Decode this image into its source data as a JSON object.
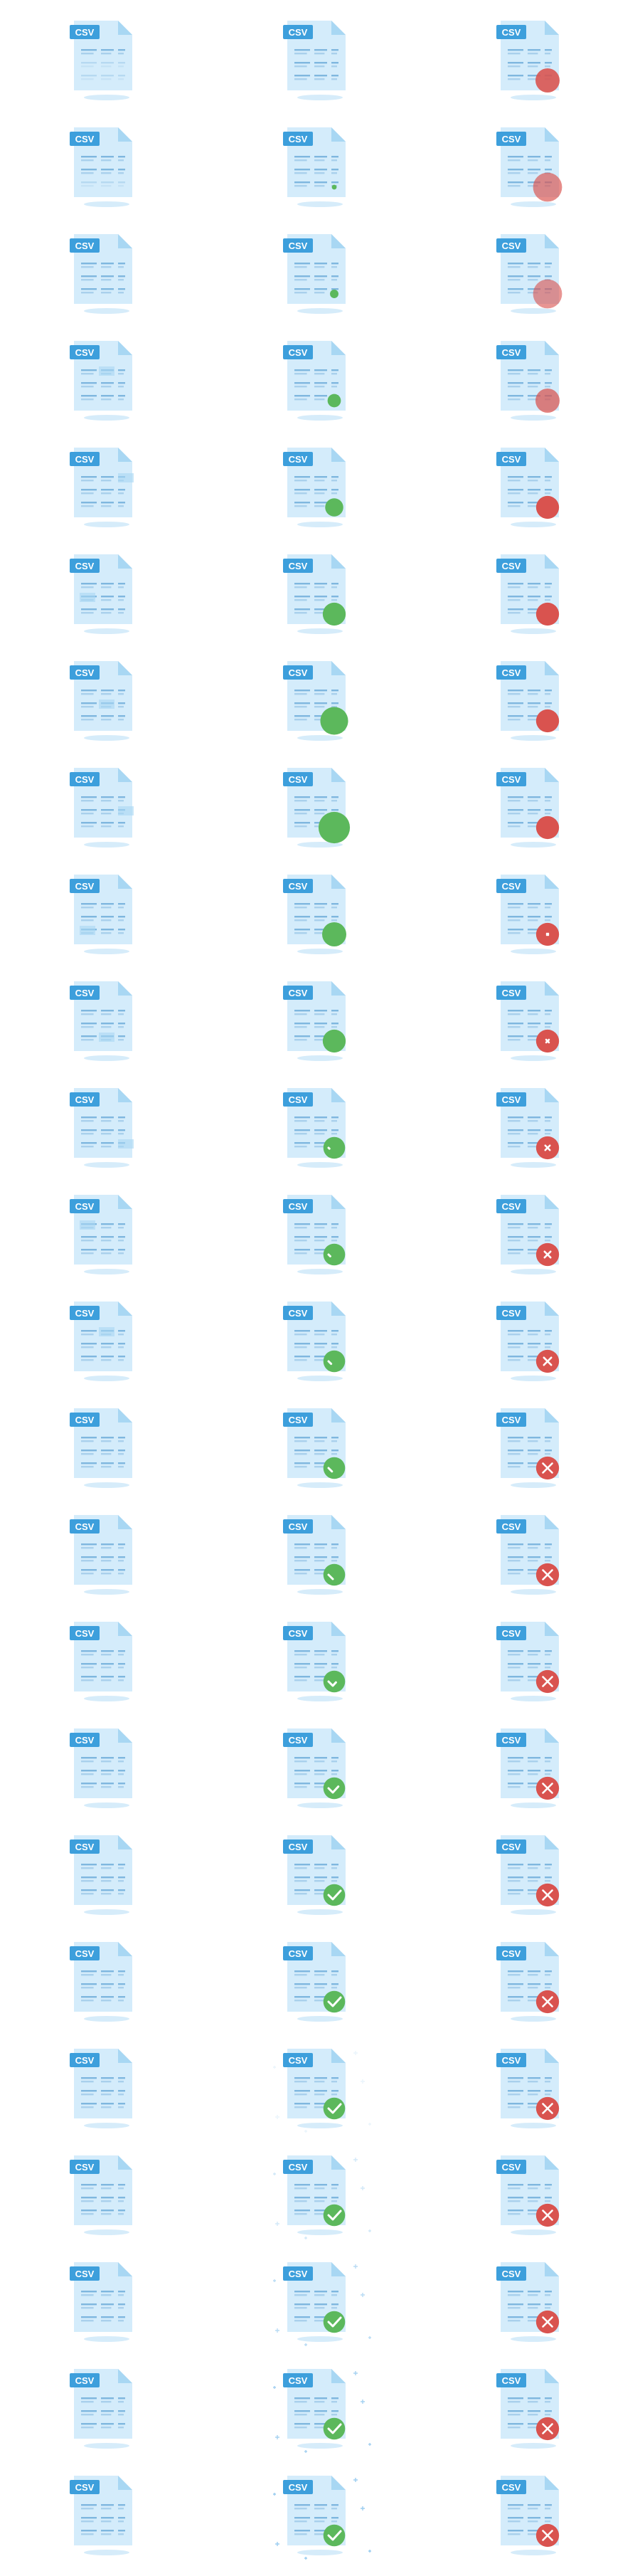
{
  "badge_label": "CSV",
  "colors": {
    "doc_body": "#d4ecfb",
    "doc_fold": "#a8d7f3",
    "doc_lines": "#7fb7df",
    "doc_lines_light": "#a9d0ec",
    "badge": "#3d9fdc",
    "shadow": "#d6ecfa",
    "success": "#5cb85c",
    "error": "#d9534f",
    "sparkle": "#9ccdf0"
  },
  "columns": [
    {
      "name": "idle",
      "frames": [
        {
          "rows": 1
        },
        {
          "rows": 2
        },
        {
          "rows": 3
        },
        {
          "rows": 3,
          "selected_cell": 1
        },
        {
          "rows": 3,
          "selected_cell": 2
        },
        {
          "rows": 3,
          "selected_cell": 3
        },
        {
          "rows": 3,
          "selected_cell": 4
        },
        {
          "rows": 3,
          "selected_cell": 5
        },
        {
          "rows": 3,
          "selected_cell": 6
        },
        {
          "rows": 3,
          "selected_cell": 7
        },
        {
          "rows": 3,
          "selected_cell": 8
        },
        {
          "rows": 3,
          "selected_cell": 9
        },
        {
          "rows": 3,
          "selected_cell": 10
        },
        {
          "rows": 3
        },
        {
          "rows": 3
        },
        {
          "rows": 3
        },
        {
          "rows": 3
        },
        {
          "rows": 3
        },
        {
          "rows": 3
        },
        {
          "rows": 3
        },
        {
          "rows": 3
        },
        {
          "rows": 3
        },
        {
          "rows": 3
        },
        {
          "rows": 3
        }
      ]
    },
    {
      "name": "success",
      "frames": [
        {
          "circle": 0
        },
        {
          "circle": 0.2
        },
        {
          "circle": 0.35
        },
        {
          "circle": 0.55
        },
        {
          "circle": 0.75
        },
        {
          "circle": 0.95
        },
        {
          "circle": 1.15
        },
        {
          "circle": 1.3
        },
        {
          "circle": 1.0
        },
        {
          "circle": 0.95
        },
        {
          "circle": 0.9,
          "mark": 0.1
        },
        {
          "circle": 0.9,
          "mark": 0.2
        },
        {
          "circle": 0.9,
          "mark": 0.3
        },
        {
          "circle": 0.9,
          "mark": 0.4
        },
        {
          "circle": 0.9,
          "mark": 0.5
        },
        {
          "circle": 0.9,
          "mark": 0.7
        },
        {
          "circle": 0.9,
          "mark": 0.85
        },
        {
          "circle": 0.9,
          "mark": 1
        },
        {
          "circle": 0.9,
          "mark": 1
        },
        {
          "circle": 0.9,
          "mark": 1,
          "sparkle": 0.2
        },
        {
          "circle": 0.9,
          "mark": 1,
          "sparkle": 0.45
        },
        {
          "circle": 0.9,
          "mark": 1,
          "sparkle": 0.7
        },
        {
          "circle": 0.9,
          "mark": 1,
          "sparkle": 0.9
        },
        {
          "circle": 0.9,
          "mark": 1,
          "sparkle": 1
        }
      ]
    },
    {
      "name": "error",
      "frames": [
        {
          "circle": 1.0,
          "blur": 0.2
        },
        {
          "circle": 1.2,
          "blur": 0.6
        },
        {
          "circle": 1.2,
          "blur": 0.7
        },
        {
          "circle": 1.0,
          "blur": 0.5
        },
        {
          "circle": 0.95,
          "blur": 0
        },
        {
          "circle": 0.95,
          "blur": 0
        },
        {
          "circle": 0.95,
          "blur": 0
        },
        {
          "circle": 0.95,
          "blur": 0
        },
        {
          "circle": 0.95,
          "cross": 0.15
        },
        {
          "circle": 0.95,
          "cross": 0.3
        },
        {
          "circle": 0.95,
          "cross": 0.5
        },
        {
          "circle": 0.95,
          "cross": 0.65
        },
        {
          "circle": 0.95,
          "cross": 0.8
        },
        {
          "circle": 0.95,
          "cross": 1
        },
        {
          "circle": 0.95,
          "cross": 1
        },
        {
          "circle": 0.95,
          "cross": 1
        },
        {
          "circle": 0.95,
          "cross": 1
        },
        {
          "circle": 0.95,
          "cross": 1
        },
        {
          "circle": 0.95,
          "cross": 1
        },
        {
          "circle": 0.95,
          "cross": 1
        },
        {
          "circle": 0.95,
          "cross": 1
        },
        {
          "circle": 0.95,
          "cross": 1
        },
        {
          "circle": 0.95,
          "cross": 1
        },
        {
          "circle": 0.95,
          "cross": 1
        }
      ]
    }
  ]
}
